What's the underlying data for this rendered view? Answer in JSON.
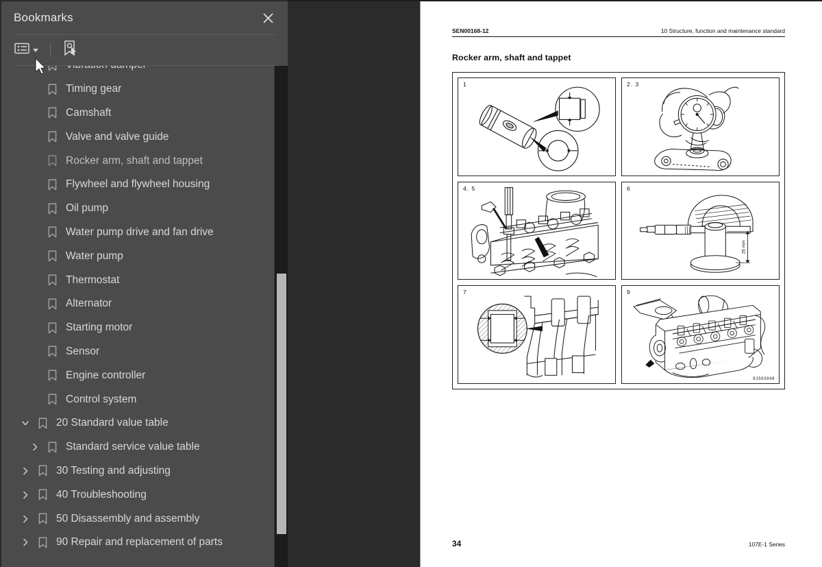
{
  "panel": {
    "title": "Bookmarks",
    "close_icon": "close-icon",
    "toolbar": {
      "options_icon": "list-options-icon",
      "options_caret_icon": "chevron-down-icon",
      "new_bookmark_icon": "new-bookmark-icon"
    },
    "collapse_handle_icon": "collapse-left-icon",
    "items": [
      {
        "label": "Vibration damper",
        "level": 1,
        "twisty": "none",
        "icon": "bookmark-icon",
        "clipped": true
      },
      {
        "label": "Timing gear",
        "level": 1,
        "twisty": "none",
        "icon": "bookmark-icon"
      },
      {
        "label": "Camshaft",
        "level": 1,
        "twisty": "none",
        "icon": "bookmark-icon"
      },
      {
        "label": "Valve and valve guide",
        "level": 1,
        "twisty": "none",
        "icon": "bookmark-icon"
      },
      {
        "label": "Rocker arm, shaft and tappet",
        "level": 1,
        "twisty": "none",
        "icon": "bookmark-icon",
        "current": true
      },
      {
        "label": "Flywheel and flywheel housing",
        "level": 1,
        "twisty": "none",
        "icon": "bookmark-icon"
      },
      {
        "label": "Oil pump",
        "level": 1,
        "twisty": "none",
        "icon": "bookmark-icon"
      },
      {
        "label": "Water pump drive and fan drive",
        "level": 1,
        "twisty": "none",
        "icon": "bookmark-icon"
      },
      {
        "label": "Water pump",
        "level": 1,
        "twisty": "none",
        "icon": "bookmark-icon"
      },
      {
        "label": "Thermostat",
        "level": 1,
        "twisty": "none",
        "icon": "bookmark-icon"
      },
      {
        "label": "Alternator",
        "level": 1,
        "twisty": "none",
        "icon": "bookmark-icon"
      },
      {
        "label": "Starting motor",
        "level": 1,
        "twisty": "none",
        "icon": "bookmark-icon"
      },
      {
        "label": "Sensor",
        "level": 1,
        "twisty": "none",
        "icon": "bookmark-icon"
      },
      {
        "label": "Engine controller",
        "level": 1,
        "twisty": "none",
        "icon": "bookmark-icon"
      },
      {
        "label": "Control system",
        "level": 1,
        "twisty": "none",
        "icon": "bookmark-icon"
      },
      {
        "label": "20 Standard value table",
        "level": 0,
        "twisty": "expanded",
        "icon": "bookmark-icon"
      },
      {
        "label": "Standard service value table",
        "level": 1,
        "twisty": "collapsed",
        "icon": "bookmark-icon"
      },
      {
        "label": "30 Testing and adjusting",
        "level": 0,
        "twisty": "collapsed",
        "icon": "bookmark-icon"
      },
      {
        "label": "40 Troubleshooting",
        "level": 0,
        "twisty": "collapsed",
        "icon": "bookmark-icon"
      },
      {
        "label": "50 Disassembly and assembly",
        "level": 0,
        "twisty": "collapsed",
        "icon": "bookmark-icon"
      },
      {
        "label": "90 Repair and replacement of parts",
        "level": 0,
        "twisty": "collapsed",
        "icon": "bookmark-icon"
      }
    ]
  },
  "document": {
    "header_left": "SEN00168-12",
    "header_right": "10 Structure, function and maintenance standard",
    "heading": "Rocker arm, shaft and tappet",
    "figure_code": "9JS03948",
    "footer_page": "34",
    "footer_right": "107E-1 Series",
    "figures": [
      {
        "num": "1",
        "caption_label": "tappet-and-bore-measurement"
      },
      {
        "num": "2. 3",
        "caption_label": "dial-gauge-on-rocker-arm"
      },
      {
        "num": "4. 5",
        "caption_label": "cylinder-head-valve-clearance"
      },
      {
        "num": "6",
        "caption_label": "micrometer-measurement",
        "dimension": "25 mm"
      },
      {
        "num": "7",
        "caption_label": "rocker-shaft-cross-section"
      },
      {
        "num": "9",
        "caption_label": "engine-head-assembly"
      }
    ]
  },
  "colors": {
    "panel_bg": "#4b4b4b",
    "viewer_bg": "#2b2b2b",
    "page_bg": "#ffffff",
    "text": "#d8d8d8",
    "scroll_track": "#1c1c1c",
    "scroll_thumb": "#b6b6b6"
  }
}
